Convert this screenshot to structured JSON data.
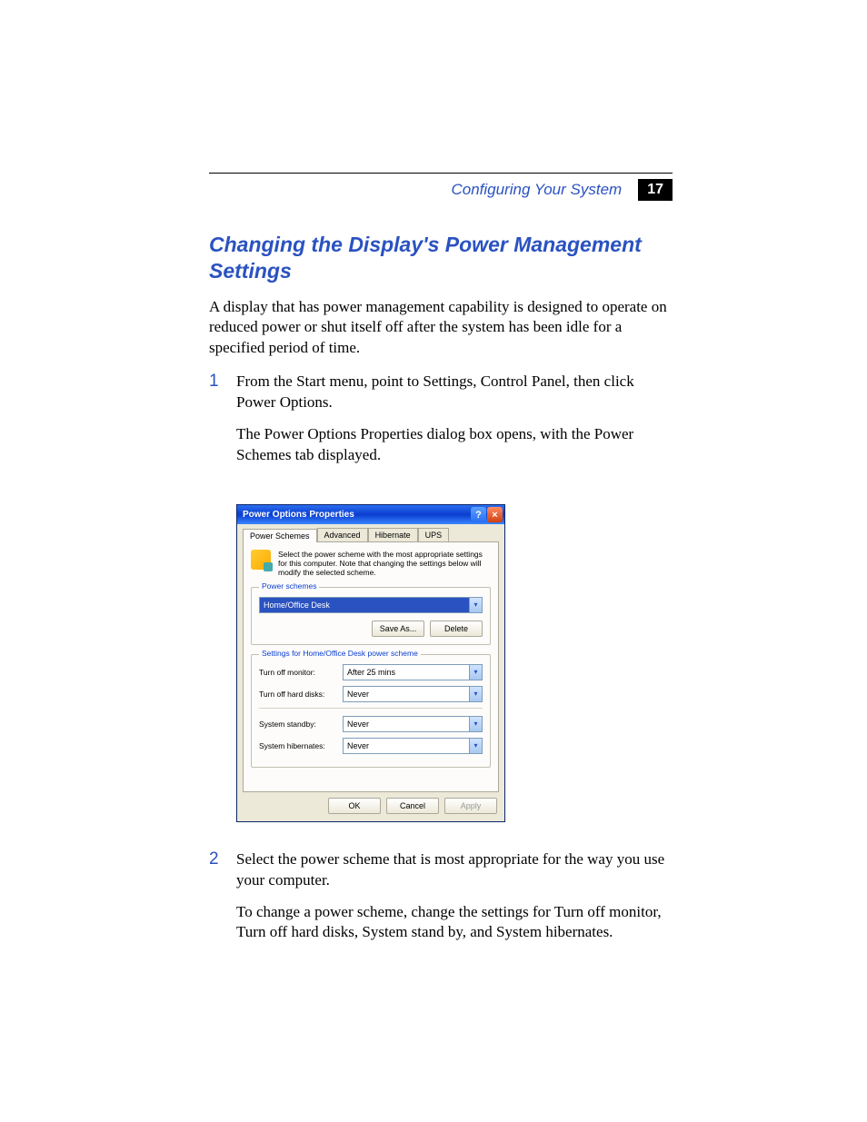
{
  "header": {
    "running_head": "Configuring Your System",
    "page_number": "17"
  },
  "heading": "Changing the Display's Power Management Settings",
  "intro": "A display that has power management capability is designed to operate on reduced power or shut itself off after the system has been idle for a specified period of time.",
  "steps": [
    {
      "num": "1",
      "paras": [
        "From the Start menu, point to Settings, Control Panel, then click Power Options.",
        "The Power Options Properties dialog box opens, with the Power Schemes tab displayed."
      ]
    },
    {
      "num": "2",
      "paras": [
        "Select the power scheme that is most appropriate for the way you use your computer.",
        "To change a power scheme, change the settings for Turn off monitor, Turn off hard disks, System stand by, and System hibernates."
      ]
    }
  ],
  "dialog": {
    "title": "Power Options Properties",
    "tabs": [
      "Power Schemes",
      "Advanced",
      "Hibernate",
      "UPS"
    ],
    "active_tab": 0,
    "description": "Select the power scheme with the most appropriate settings for this computer. Note that changing the settings below will modify the selected scheme.",
    "group1": {
      "label": "Power schemes",
      "scheme": "Home/Office Desk",
      "save_as": "Save As...",
      "delete": "Delete"
    },
    "group2": {
      "label": "Settings for Home/Office Desk power scheme",
      "rows": [
        {
          "label": "Turn off monitor:",
          "value": "After 25 mins"
        },
        {
          "label": "Turn off hard disks:",
          "value": "Never"
        },
        {
          "label": "System standby:",
          "value": "Never"
        },
        {
          "label": "System hibernates:",
          "value": "Never"
        }
      ]
    },
    "buttons": {
      "ok": "OK",
      "cancel": "Cancel",
      "apply": "Apply"
    }
  }
}
